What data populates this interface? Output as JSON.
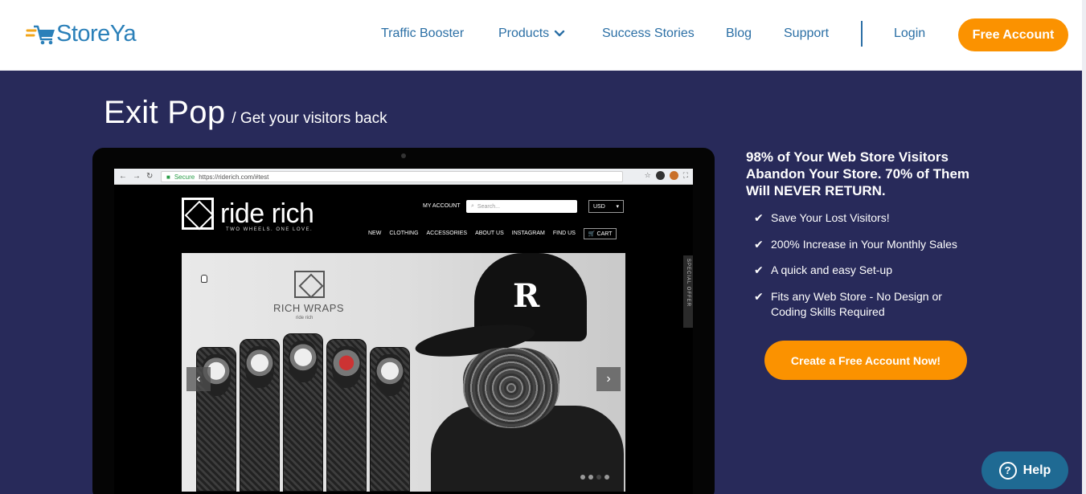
{
  "brand": {
    "name": "StoreYa"
  },
  "nav": {
    "items": [
      {
        "label": "Traffic Booster"
      },
      {
        "label": "Products",
        "icon": "chevron-down-icon"
      },
      {
        "label": "Success Stories"
      },
      {
        "label": "Blog"
      },
      {
        "label": "Support"
      }
    ],
    "login": "Login",
    "free_account": "Free Account"
  },
  "hero": {
    "title": "Exit Pop",
    "subtitle": "/ Get your visitors back"
  },
  "mockup": {
    "url_secure": "Secure",
    "url": "https://riderich.com/#test",
    "site_name": "ride rich",
    "site_tagline": "TWO WHEELS. ONE LOVE.",
    "my_account": "MY ACCOUNT",
    "search_placeholder": "Search...",
    "currency": "USD",
    "site_nav": [
      "NEW",
      "CLOTHING",
      "ACCESSORIES",
      "ABOUT US",
      "INSTAGRAM",
      "FIND US"
    ],
    "cart": "CART",
    "slide_title": "RICH WRAPS",
    "slide_sub": "ride rich",
    "special_offer": "SPECIAL OFFER"
  },
  "pitch": {
    "headline": "98% of Your Web Store Visitors Abandon Your Store. 70% of Them Will NEVER RETURN."
  },
  "features": [
    {
      "text": "Save Your Lost Visitors!"
    },
    {
      "text": "200% Increase in Your Monthly Sales"
    },
    {
      "text": "A quick and easy Set-up"
    },
    {
      "text": "Fits any Web Store - No Design or Coding Skills Required"
    }
  ],
  "cta": {
    "label": "Create a Free Account Now!"
  },
  "help": {
    "label": "Help"
  },
  "colors": {
    "brand_blue": "#2b80b9",
    "navy_bg": "#282a5a",
    "orange": "#fb9200",
    "help_blue": "#1f6a93"
  }
}
